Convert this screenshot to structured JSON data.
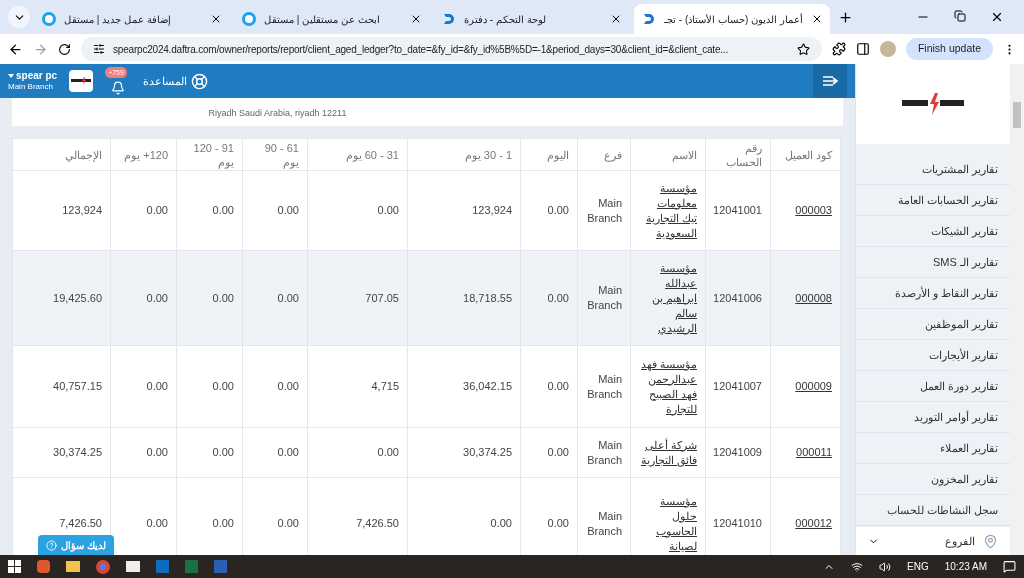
{
  "browser": {
    "tabs": [
      {
        "title": "أعمار الديون (حساب الأستاذ) - تجـ",
        "selected": true,
        "kind": "d"
      },
      {
        "title": "لوحة التحكم - دفترة",
        "selected": false,
        "kind": "d"
      },
      {
        "title": "ابحث عن مستقلين | مستقل",
        "selected": false,
        "kind": "ring"
      },
      {
        "title": "إضافة عمل جديد | مستقل",
        "selected": false,
        "kind": "ring"
      }
    ],
    "url": "spearpc2024.daftra.com/owner/reports/report/client_aged_ledger?to_date=&fy_id=&fy_id%5B%5D=-1&period_days=30&client_id=&client_cate...",
    "update_button": "Finish update"
  },
  "app_header": {
    "account_name": "spear pc",
    "branch": "Main Branch",
    "notification_count": "+759",
    "help": "المساعدة"
  },
  "company_address": "Riyadh Saudi Arabia, riyadh 12211",
  "table": {
    "columns": [
      "كود العميل",
      "رقم الحساب",
      "الاسم",
      "فرع",
      "اليوم",
      "1 - 30 يوم",
      "31 - 60 يوم",
      "61 - 90 يوم",
      "91 - 120 يوم",
      "120+ يوم",
      "الإجمالي"
    ],
    "rows": [
      {
        "highlighted": false,
        "cells": [
          "000003",
          "12041001",
          "مؤسسة معلومات تيك التجارية السعودية",
          "Main Branch",
          "0.00",
          "123,924",
          "0.00",
          "0.00",
          "0.00",
          "0.00",
          "123,924"
        ]
      },
      {
        "highlighted": true,
        "cells": [
          "000008",
          "12041006",
          "مؤسسة عبدالله ابراهيم بن سالم الرشيدي",
          "Main Branch",
          "0.00",
          "18,718.55",
          "707.05",
          "0.00",
          "0.00",
          "0.00",
          "19,425.60"
        ]
      },
      {
        "highlighted": false,
        "cells": [
          "000009",
          "12041007",
          "مؤسسة فهد عبدالرحمن فهد الصبيح للتجارة",
          "Main Branch",
          "0.00",
          "36,042.15",
          "4,715",
          "0.00",
          "0.00",
          "0.00",
          "40,757.15"
        ]
      },
      {
        "highlighted": false,
        "cells": [
          "000011",
          "12041009",
          "شركة أعلى فائق التجارية",
          "Main Branch",
          "0.00",
          "30,374.25",
          "0.00",
          "0.00",
          "0.00",
          "0.00",
          "30,374.25"
        ]
      },
      {
        "highlighted": false,
        "cells": [
          "000012",
          "12041010",
          "مؤسسة حلول الحاسوب لصيانة",
          "Main Branch",
          "0.00",
          "0.00",
          "7,426.50",
          "0.00",
          "0.00",
          "0.00",
          "7,426.50"
        ]
      }
    ]
  },
  "sidebar": {
    "items": [
      "تقارير المشتريات",
      "تقارير الحسابات العامة",
      "تقارير الشيكات",
      "تقارير الـ SMS",
      "تقارير النقاط و الأرصدة",
      "تقارير الموظفين",
      "تقارير الأيجارات",
      "تقارير دورة العمل",
      "تقارير أوامر التوريد",
      "تقارير العملاء",
      "تقارير المخزون",
      "سجل النشاطات للحساب"
    ],
    "footer": "الفروع"
  },
  "help_button": "لديك سؤال",
  "taskbar": {
    "language": "ENG",
    "time": "10:23 AM"
  }
}
